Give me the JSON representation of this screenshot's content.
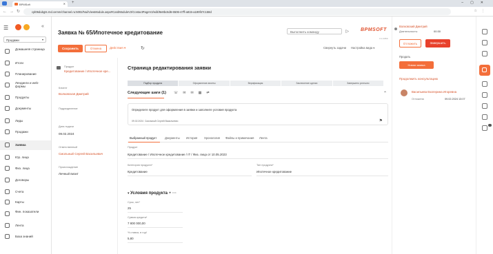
{
  "browser": {
    "tab_title": "BPMSoft",
    "url": "cpl06dubgts.rnd.cemm/channel.ru:5002/Nui/ViewModule.aspx#CardModuleV2/ContactPageV2/edit/8e8bc6d6-6506-47ff-a815-a199f47c158d"
  },
  "workspace": {
    "selected": "Продажи"
  },
  "nav": [
    {
      "label": "Домашняя страница",
      "active": false
    },
    {
      "label": "Итоги",
      "active": false
    },
    {
      "label": "Планирование",
      "active": false
    },
    {
      "label": "Лендинги и web-формы",
      "active": false
    },
    {
      "label": "Продукты",
      "active": false
    },
    {
      "label": "Документы",
      "active": false
    },
    {
      "label": "Лиды",
      "active": false
    },
    {
      "label": "Продажи",
      "active": false
    },
    {
      "label": "Заявка",
      "active": true
    },
    {
      "label": "Юр. лица",
      "active": false
    },
    {
      "label": "Физ. лица",
      "active": false
    },
    {
      "label": "Договоры",
      "active": false
    },
    {
      "label": "Счета",
      "active": false
    },
    {
      "label": "Карты",
      "active": false
    },
    {
      "label": "Фин. показатели",
      "active": false
    },
    {
      "label": "Лента",
      "active": false
    },
    {
      "label": "База знаний",
      "active": false
    }
  ],
  "header": {
    "title": "Заявка № 65/Ипотечное кредитование",
    "command_placeholder": "Выполнить команду",
    "brand": "BPMSOFT",
    "brand_sub": "3.1.0.860",
    "save": "Сохранить",
    "cancel": "Отмена",
    "actions": "Действия ▾",
    "completeness": "Свернуть задачи",
    "view_settings": "Настройка вида ▾"
  },
  "profile": {
    "product_label": "Продукт",
    "product_value": "Кредитование / Ипотечное кре...",
    "client_label": "Клиент",
    "client_value": "Волковская Дмитрий",
    "division_label": "Подразделение",
    "created_label": "Дата подачи",
    "created_value": "09.02.2024",
    "owner_label": "Ответственный",
    "owner_value": "Смольный Сергей Васильевич",
    "origin_label": "Происхождение",
    "origin_value": "Личный визит"
  },
  "center": {
    "edit_title": "Страница редактирования заявки",
    "stages": [
      "Подбор продукта",
      "Оформление анкеты",
      "Верификация",
      "Заключение сделки",
      "Завершено успешно"
    ],
    "steps_title": "Следующие шаги (1)",
    "task_text": "Определите продукт для оформления в заявке и заполните условия продукта",
    "task_date": "09.02.2024",
    "task_owner": "Смольный Сергей Васильевич",
    "tabs": [
      "Выбранный продукт",
      "Документы",
      "История",
      "Хронология",
      "Файлы и примечания",
      "Лента"
    ],
    "product_label": "Продукт",
    "product_value": "Кредитование / Ипотечное кредитование / IT / Физ. лица от 10.05.2023",
    "category_label": "Категория продукта*",
    "category_value": "Кредитование",
    "type_label": "Тип продукта*",
    "type_value": "Ипотечное кредитование",
    "conditions_title": "Условия продукта",
    "term_label": "Срок, лет*",
    "term_value": "25",
    "amount_label": "Сумма кредита*",
    "amount_value": "7 800 000,00",
    "rate_label": "% ставка, в год*",
    "rate_value": "5,80"
  },
  "right": {
    "owner": "Волковский Дмитрий",
    "duration_label": "Длительность:",
    "duration_value": "00:30",
    "cancel": "Отложить",
    "finish": "Завершить",
    "sale_label": "Продать",
    "new_request": "Новая заявка",
    "next_label": "Продолжить консультацию",
    "person": "Васильева Екатерина Игоревна",
    "status": "Отложена",
    "date": "09.02.2024 13:07"
  }
}
